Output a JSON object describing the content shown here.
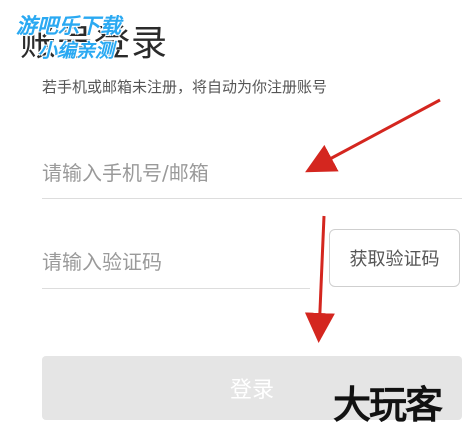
{
  "login": {
    "title": "账号登录",
    "subtitle": "若手机或邮箱未注册，将自动为你注册账号",
    "phone_placeholder": "请输入手机号/邮箱",
    "code_placeholder": "请输入验证码",
    "get_code_label": "获取验证码",
    "login_label": "登录"
  },
  "watermarks": {
    "top_line1": "游吧乐下载",
    "top_line2": "小编亲测",
    "bottom": "大玩客"
  },
  "colors": {
    "arrow": "#d4261f",
    "login_button_bg": "#e5e5e5",
    "watermark_blue": "#2aa9f2"
  }
}
